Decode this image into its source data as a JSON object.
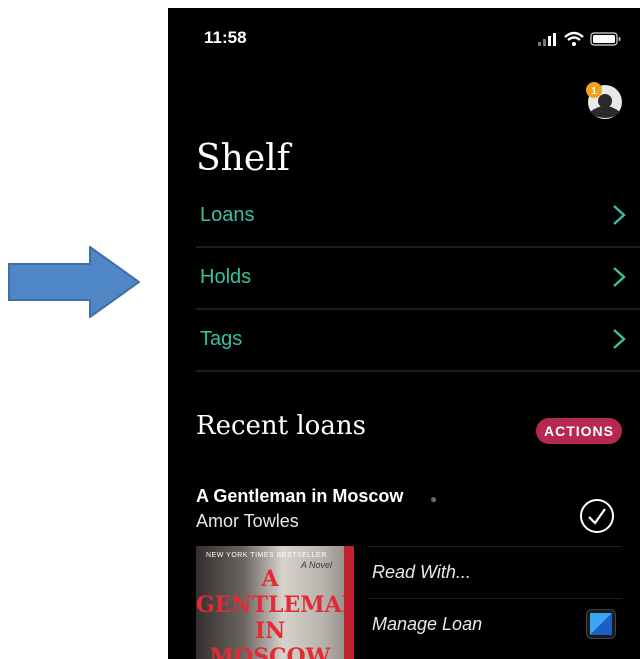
{
  "status_bar": {
    "time": "11:58"
  },
  "account": {
    "badge_count": "1"
  },
  "shelf": {
    "title": "Shelf",
    "nav_items": [
      {
        "label": "Loans"
      },
      {
        "label": "Holds"
      },
      {
        "label": "Tags"
      }
    ]
  },
  "recent_loans": {
    "title": "Recent loans",
    "actions_label": "ACTIONS",
    "book": {
      "title": "A Gentleman in Moscow",
      "author": "Amor Towles",
      "cover": {
        "top_banner": "NEW YORK TIMES BESTSELLER",
        "subtitle": "A Novel",
        "title_lines": [
          "A",
          "GENTLEMAN",
          "IN",
          "MOSCOW"
        ]
      },
      "actions": [
        {
          "label": "Read With..."
        },
        {
          "label": "Manage Loan"
        }
      ]
    }
  },
  "colors": {
    "accent": "#35c2a1",
    "actions_badge": "#b7284e",
    "background": "#000000",
    "arrow_fill": "#4f86c6"
  }
}
